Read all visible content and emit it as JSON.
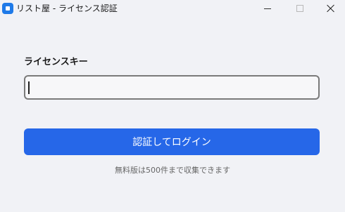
{
  "window": {
    "title": "リスト屋 - ライセンス認証",
    "app_icon": "app-logo-icon",
    "controls": [
      "minimize-icon",
      "maximize-icon",
      "close-icon"
    ]
  },
  "form": {
    "license_label": "ライセンスキー",
    "license_value": "",
    "submit_label": "認証してログイン",
    "note": "無料版は500件まで収集できます"
  },
  "colors": {
    "background": "#f1f2f6",
    "button": "#2667e8",
    "input_border": "#7a7a7a",
    "note_text": "#666666"
  }
}
